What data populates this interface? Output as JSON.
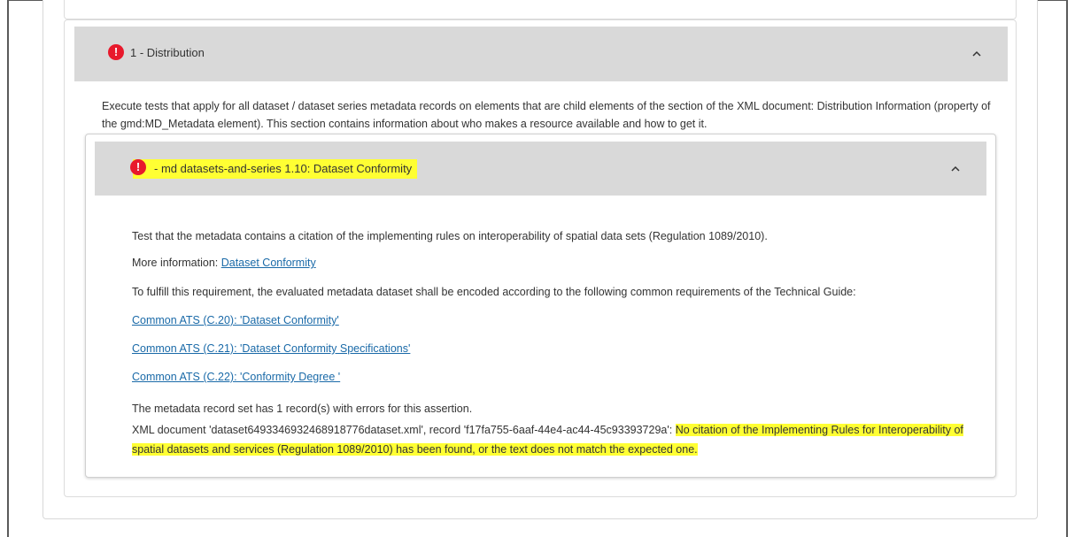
{
  "section": {
    "title": "1 - Distribution",
    "description": "Execute tests that apply for all dataset / dataset series metadata records on elements that are child elements of the section of the XML document: Distribution Information (property of the gmd:MD_Metadata element). This section contains information about who makes a resource available and how to get it."
  },
  "rule": {
    "title": " - md datasets-and-series 1.10: Dataset Conformity",
    "intro": "Test that the metadata contains a citation of the implementing rules on interoperability of spatial data sets (Regulation 1089/2010).",
    "more_info_label": "More information: ",
    "more_info_link": "Dataset Conformity",
    "fulfill_text": "To fulfill this requirement, the evaluated metadata dataset shall be encoded according to the following common requirements of the Technical Guide:",
    "links": [
      "Common ATS (C.20): 'Dataset Conformity'",
      "Common ATS (C.21): 'Dataset Conformity Specifications'",
      "Common ATS (C.22): 'Conformity Degree '"
    ],
    "error_summary": "The metadata record set has 1 record(s) with errors for this assertion.",
    "error_prefix": "XML document 'dataset6493346932468918776dataset.xml', record 'f17fa755-6aaf-44e4-ac44-45c93393729a': ",
    "error_message": "No citation of the Implementing Rules for Interoperability of spatial datasets and services (Regulation 1089/2010) has been found, or the text does not match the expected one."
  },
  "icons": {
    "error": "exclamation-circle-icon",
    "collapse": "chevron-up-icon"
  },
  "colors": {
    "error_red": "#e8192c",
    "highlight": "#ffff33",
    "link": "#1a6aa8",
    "header_bg": "#d9d9d9"
  }
}
